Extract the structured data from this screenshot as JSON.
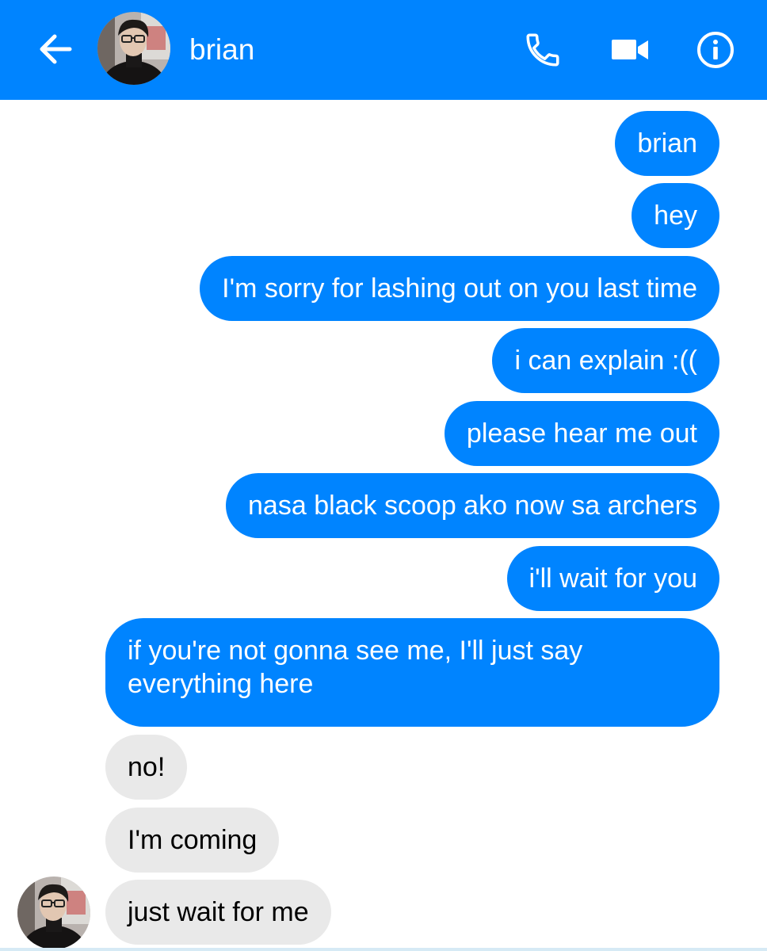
{
  "header": {
    "contact_name": "brian",
    "back_icon": "arrow-left-icon",
    "call_icon": "phone-icon",
    "video_icon": "video-camera-icon",
    "info_icon": "info-icon",
    "background_color": "#0084ff"
  },
  "messages": [
    {
      "sender": "me",
      "text": "brian"
    },
    {
      "sender": "me",
      "text": "hey"
    },
    {
      "sender": "me",
      "text": "I'm sorry for lashing out on you last time"
    },
    {
      "sender": "me",
      "text": "i can explain :(("
    },
    {
      "sender": "me",
      "text": "please hear me out"
    },
    {
      "sender": "me",
      "text": "nasa black scoop ako now sa archers"
    },
    {
      "sender": "me",
      "text": "i'll wait for you"
    },
    {
      "sender": "me",
      "text": "if you're not gonna see me, I'll just say everything here"
    },
    {
      "sender": "brian",
      "text": "no!"
    },
    {
      "sender": "brian",
      "text": "I'm coming"
    },
    {
      "sender": "brian",
      "text": "just wait for me"
    }
  ],
  "colors": {
    "outgoing_bubble": "#0084ff",
    "incoming_bubble": "#e9e9e9"
  }
}
